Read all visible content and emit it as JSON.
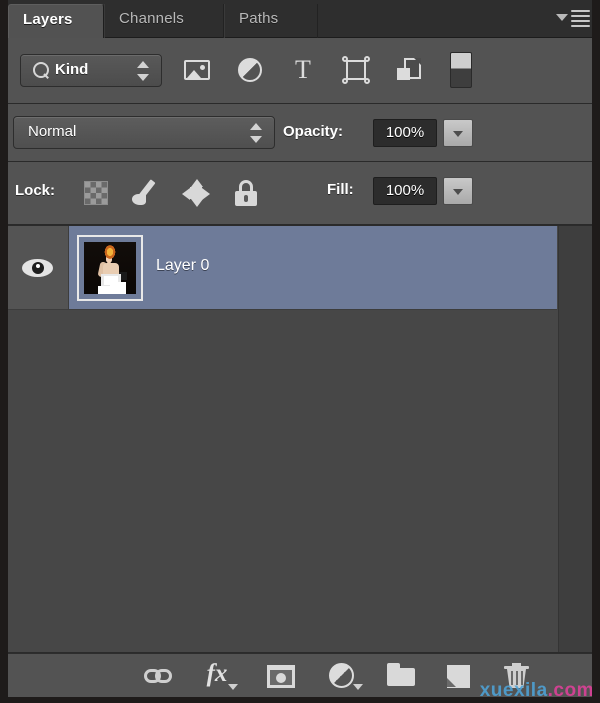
{
  "panel": {
    "title": "Layers",
    "tabs": [
      {
        "label": "Layers",
        "active": true
      },
      {
        "label": "Channels",
        "active": false
      },
      {
        "label": "Paths",
        "active": false
      }
    ],
    "menu_icon": "panel-menu-icon"
  },
  "filter": {
    "kind_label": "Kind",
    "search_icon": "magnifier-icon",
    "icons": [
      {
        "name": "filter-pixel-layers-icon",
        "title": "Pixel Layers"
      },
      {
        "name": "filter-adjustment-layers-icon",
        "title": "Adjustment Layers"
      },
      {
        "name": "filter-type-layers-icon",
        "title": "Type Layers"
      },
      {
        "name": "filter-shape-layers-icon",
        "title": "Shape Layers"
      },
      {
        "name": "filter-smart-objects-icon",
        "title": "Smart Objects"
      }
    ],
    "toggle_name": "filter-enable-toggle"
  },
  "blend": {
    "mode": "Normal",
    "opacity_label": "Opacity:",
    "opacity_value": "100%"
  },
  "lock": {
    "label": "Lock:",
    "buttons": [
      {
        "name": "lock-transparent-pixels",
        "icon": "checkerboard-icon"
      },
      {
        "name": "lock-image-pixels",
        "icon": "paintbrush-icon"
      },
      {
        "name": "lock-position",
        "icon": "move-arrows-icon"
      },
      {
        "name": "lock-all",
        "icon": "padlock-icon"
      }
    ],
    "fill_label": "Fill:",
    "fill_value": "100%"
  },
  "layers": [
    {
      "name": "Layer 0",
      "visible": true,
      "selected": true,
      "visibility_icon": "eye-icon",
      "thumbnail": "layer-thumbnail"
    }
  ],
  "bottom_toolbar": [
    {
      "name": "link-layers-button",
      "icon": "chain-link-icon"
    },
    {
      "name": "layer-style-button",
      "icon": "fx-icon",
      "label": "fx"
    },
    {
      "name": "add-layer-mask-button",
      "icon": "layer-mask-icon"
    },
    {
      "name": "new-adjustment-layer-button",
      "icon": "half-circle-icon"
    },
    {
      "name": "new-group-button",
      "icon": "folder-icon"
    },
    {
      "name": "new-layer-button",
      "icon": "new-page-icon"
    },
    {
      "name": "delete-layer-button",
      "icon": "trash-can-icon"
    }
  ],
  "watermark": {
    "part1": "xuexila",
    "part2": ".com"
  },
  "colors": {
    "panel_bg": "#2b2b2b",
    "toolbar_bg": "#535353",
    "list_bg": "#474747",
    "selected_row": "#6e7b99",
    "text": "#ffffff",
    "icon": "#d8d8d8",
    "watermark_blue": "#4ea3d8",
    "watermark_pink": "#e0409a"
  }
}
